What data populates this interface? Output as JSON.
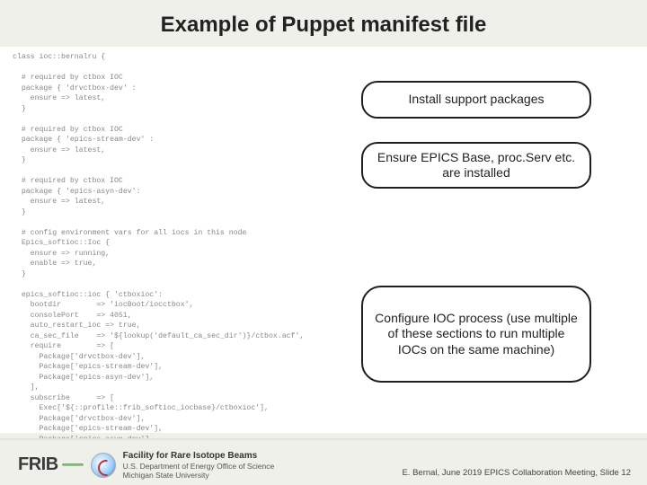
{
  "title": "Example of Puppet manifest file",
  "callouts": {
    "install": "Install support packages",
    "ensure": "Ensure EPICS Base, proc.Serv etc. are installed",
    "configure": "Configure IOC process\n(use multiple of these sections to run multiple IOCs on the same machine)"
  },
  "code": "class ioc::bernalru {\n\n  # required by ctbox IOC\n  package { 'drvctbox-dev' :\n    ensure => latest,\n  }\n\n  # required by ctbox IOC\n  package { 'epics-stream-dev' :\n    ensure => latest,\n  }\n\n  # required by ctbox IOC\n  package { 'epics-asyn-dev':\n    ensure => latest,\n  }\n\n  # config environment vars for all iocs in this node\n  Epics_softioc::Ioc {\n    ensure => running,\n    enable => true,\n  }\n\n  epics_softioc::ioc { 'ctboxioc':\n    bootdir        => 'iocBoot/iocctbox',\n    consolePort    => 4051,\n    auto_restart_ioc => true,\n    ca_sec_file    => '${lookup('default_ca_sec_dir')}/ctbox.acf',\n    require        => [\n      Package['drvctbox-dev'],\n      Package['epics-stream-dev'],\n      Package['epics-asyn-dev'],\n    ],\n    subscribe      => [\n      Exec['${::profile::frib_softioc_iocbase}/ctboxioc'],\n      Package['drvctbox-dev'],\n      Package['epics-stream-dev'],\n      Package['epics-asyn-dev'],\n    ],\n  }\n}",
  "footer": {
    "frib_mark": "FRIB",
    "facility_line1": "Facility for Rare Isotope Beams",
    "facility_line2": "U.S. Department of Energy Office of Science",
    "facility_line3": "Michigan State University",
    "meta": "E. Bernal, June 2019 EPICS Collaboration Meeting, Slide 12"
  }
}
